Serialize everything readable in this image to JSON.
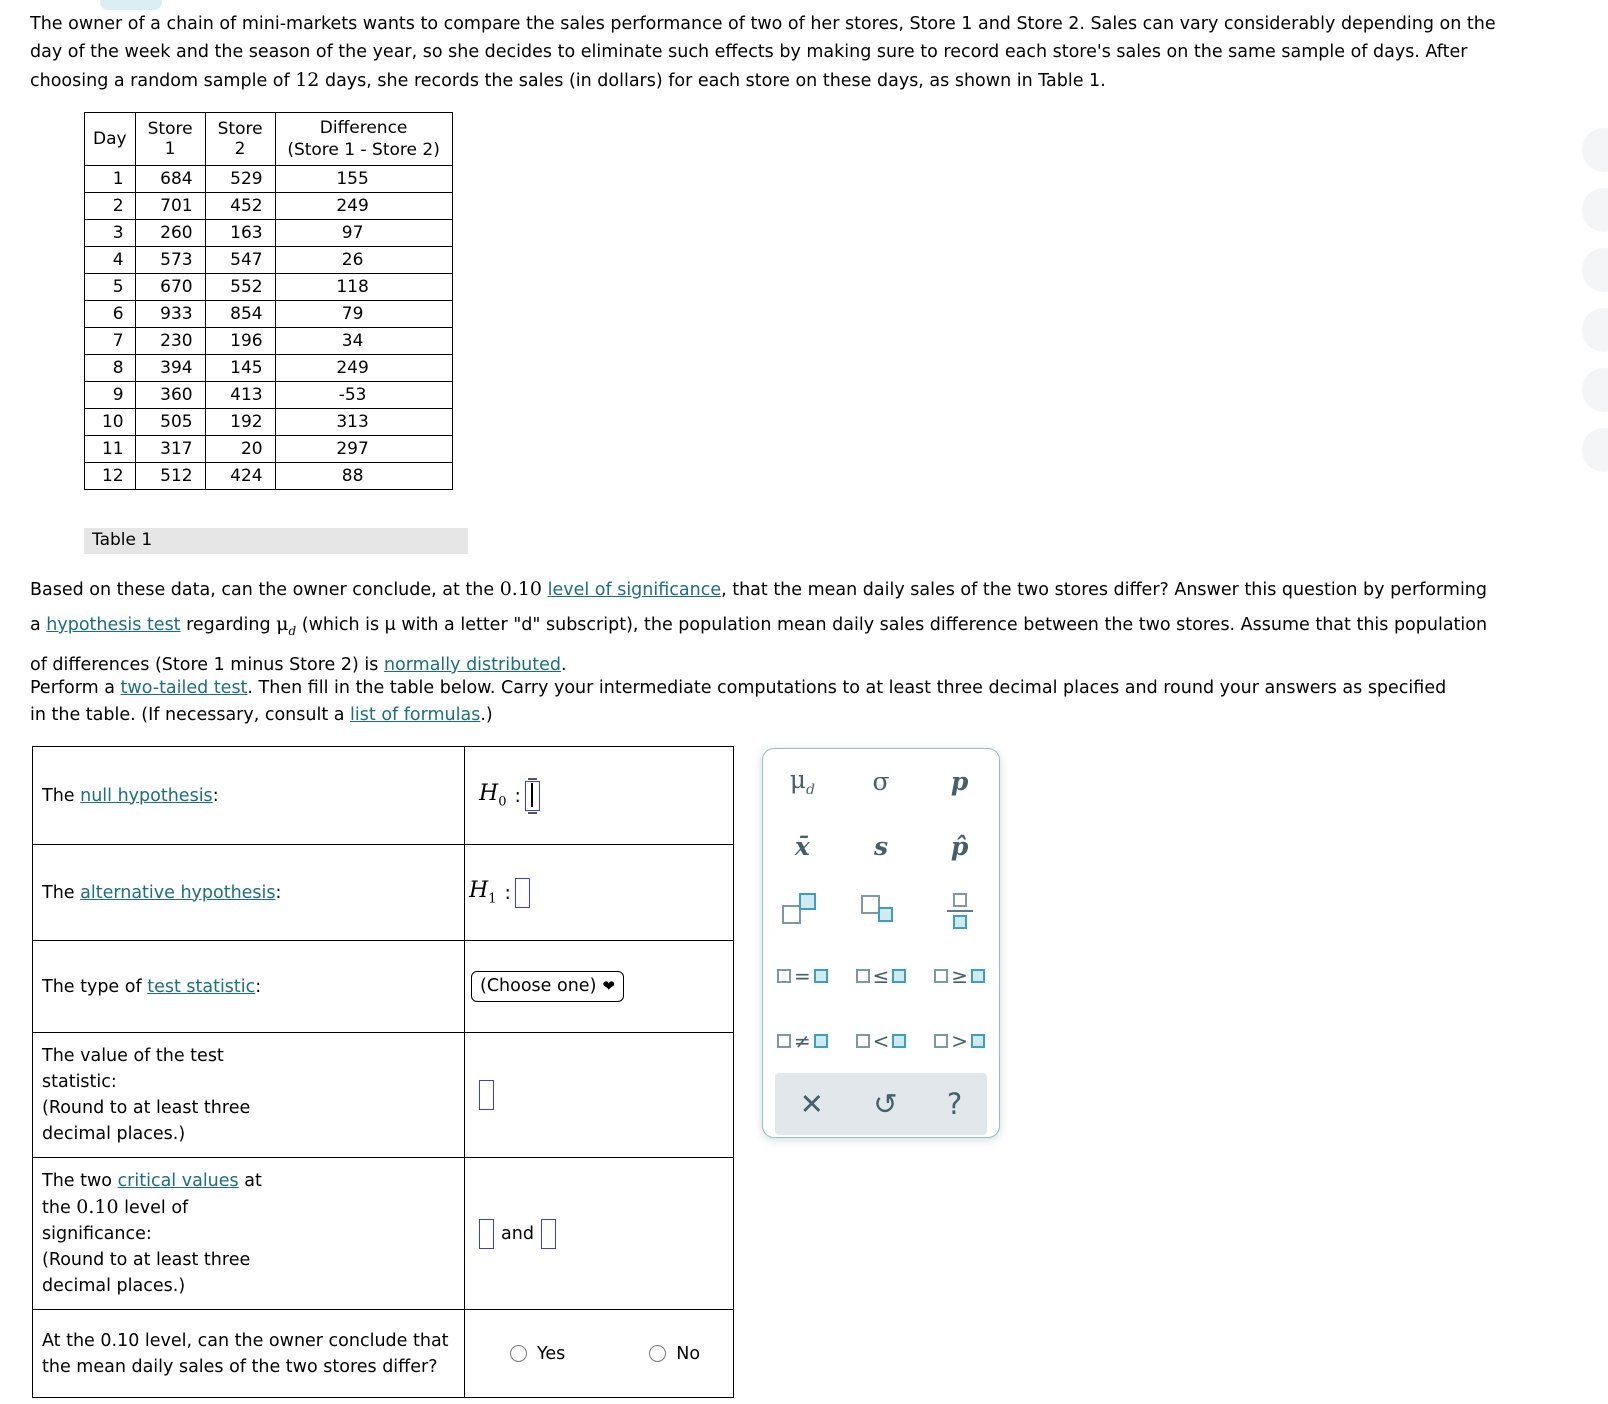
{
  "intro": {
    "text_part_1": "The owner of a chain of mini-markets wants to compare the sales performance of two of her stores, Store 1 and Store 2. Sales can vary considerably depending on the day of the week and the season of the year, so she decides to eliminate such effects by making sure to record each store's sales on the same sample of days. After choosing a random sample of ",
    "sample_size": "12",
    "text_part_2": " days, she records the sales (in dollars) for each store on these days, as shown in Table 1."
  },
  "data_table": {
    "headers": [
      "Day",
      "Store 1",
      "Store 2",
      "Difference\n(Store 1 - Store 2)"
    ],
    "header_diff_line1": "Difference",
    "header_diff_line2": "(Store 1 - Store 2)",
    "caption": "Table 1",
    "rows": [
      {
        "day": "1",
        "store1": "684",
        "store2": "529",
        "diff": "155"
      },
      {
        "day": "2",
        "store1": "701",
        "store2": "452",
        "diff": "249"
      },
      {
        "day": "3",
        "store1": "260",
        "store2": "163",
        "diff": "97"
      },
      {
        "day": "4",
        "store1": "573",
        "store2": "547",
        "diff": "26"
      },
      {
        "day": "5",
        "store1": "670",
        "store2": "552",
        "diff": "118"
      },
      {
        "day": "6",
        "store1": "933",
        "store2": "854",
        "diff": "79"
      },
      {
        "day": "7",
        "store1": "230",
        "store2": "196",
        "diff": "34"
      },
      {
        "day": "8",
        "store1": "394",
        "store2": "145",
        "diff": "249"
      },
      {
        "day": "9",
        "store1": "360",
        "store2": "413",
        "diff": "-53"
      },
      {
        "day": "10",
        "store1": "505",
        "store2": "192",
        "diff": "313"
      },
      {
        "day": "11",
        "store1": "317",
        "store2": "20",
        "diff": "297"
      },
      {
        "day": "12",
        "store1": "512",
        "store2": "424",
        "diff": "88"
      }
    ]
  },
  "paragraph1": {
    "s1": "Based on these data, can the owner conclude, at the ",
    "alpha": "0.10",
    "link_level": "level of significance",
    "s2": ", that the mean daily sales of the two stores differ? Answer this question by performing a ",
    "link_hypothesis_test": "hypothesis test",
    "s3": " regarding ",
    "mu_symbol": "μ",
    "mu_sub": "d",
    "s4": " (which is μ with a letter \"d\" subscript), the population mean daily sales difference between the two stores. Assume that this population of differences (Store 1 minus Store 2) is ",
    "link_normal": "normally distributed",
    "s5": "."
  },
  "paragraph2": {
    "s1": "Perform a ",
    "link_two_tailed": "two-tailed test",
    "s2": ". Then fill in the table below. Carry your intermediate computations to at least three decimal places and round your answers as specified in the table. (If necessary, consult a ",
    "link_formulas": "list of formulas",
    "s3": ".)"
  },
  "form": {
    "row_null": {
      "label_prefix": "The ",
      "label_link": "null hypothesis",
      "label_suffix": ":",
      "symbol": "H",
      "symbol_sub": "0",
      "colon": ":"
    },
    "row_alt": {
      "label_prefix": "The ",
      "label_link": "alternative hypothesis",
      "label_suffix": ":",
      "symbol": "H",
      "symbol_sub": "1",
      "colon": ":"
    },
    "row_type": {
      "label_prefix": "The type of ",
      "label_link": "test statistic",
      "label_suffix": ":",
      "select_value": "(Choose one)",
      "select_caret": "❤"
    },
    "row_value": {
      "line1": "The value of the test",
      "line2": "statistic:",
      "line3": "(Round to at least three",
      "line4": "decimal places.)"
    },
    "row_critical": {
      "line1_prefix": "The two ",
      "line1_link": "critical values",
      "line1_suffix": " at",
      "line2_prefix": "the ",
      "line2_alpha": "0.10",
      "line2_suffix": " level of",
      "line3": "significance:",
      "line4": "(Round to at least three",
      "line5": "decimal places.)",
      "and_text": "and"
    },
    "row_conclusion": {
      "line1": "At the 0.10 level, can the owner conclude that",
      "line2": "the mean daily sales of the two stores differ?",
      "option_yes": "Yes",
      "option_no": "No"
    }
  },
  "palette": {
    "symbols": [
      {
        "name": "mu-d",
        "main": "μ",
        "sub": "d"
      },
      {
        "name": "sigma",
        "main": "σ",
        "sub": ""
      },
      {
        "name": "p",
        "main": "p",
        "sub": ""
      },
      {
        "name": "x-bar",
        "main": "x̄",
        "sub": ""
      },
      {
        "name": "s",
        "main": "s",
        "sub": ""
      },
      {
        "name": "p-hat",
        "main": "p̂",
        "sub": ""
      }
    ],
    "operators": [
      {
        "name": "equals",
        "op": "="
      },
      {
        "name": "less-equal",
        "op": "≤"
      },
      {
        "name": "greater-equal",
        "op": "≥"
      },
      {
        "name": "not-equal",
        "op": "≠"
      },
      {
        "name": "less-than",
        "op": "<"
      },
      {
        "name": "greater-than",
        "op": ">"
      }
    ],
    "footer_buttons": [
      {
        "name": "clear",
        "glyph": "✕"
      },
      {
        "name": "undo",
        "glyph": "↺"
      },
      {
        "name": "help",
        "glyph": "?"
      }
    ]
  },
  "colors": {
    "link": "#1b6f7d",
    "input_border": "#3a41d8",
    "palette_border": "#9dbcc4",
    "palette_accent": "#3e9ebb",
    "palette_fill": "#cfeaf3",
    "palette_footer": "#e1e7ea",
    "caption_bg": "#e6e6e6",
    "tab_blue": "#daeef3"
  }
}
